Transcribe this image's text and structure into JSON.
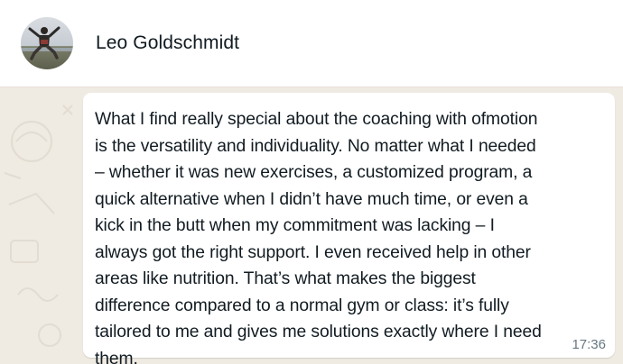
{
  "header": {
    "contact_name": "Leo Goldschmidt",
    "avatar_icon": "profile-photo"
  },
  "message": {
    "text": "What I find really special about the coaching with ofmotion\nis the versatility and individuality. No matter what I needed\n– whether it was new exercises, a customized program, a\nquick alternative when I didn’t have much time, or even a\nkick in the butt when my commitment was lacking – I\nalways got the right support. I even received help in other\nareas like nutrition. That’s what makes the biggest\ndifference compared to a normal gym or class: it’s fully\ntailored to me and gives me solutions exactly where I need\nthem.",
    "time": "17:36"
  },
  "colors": {
    "chat_background": "#efeae2",
    "bubble": "#ffffff",
    "text": "#111b21",
    "timestamp": "#667781"
  }
}
